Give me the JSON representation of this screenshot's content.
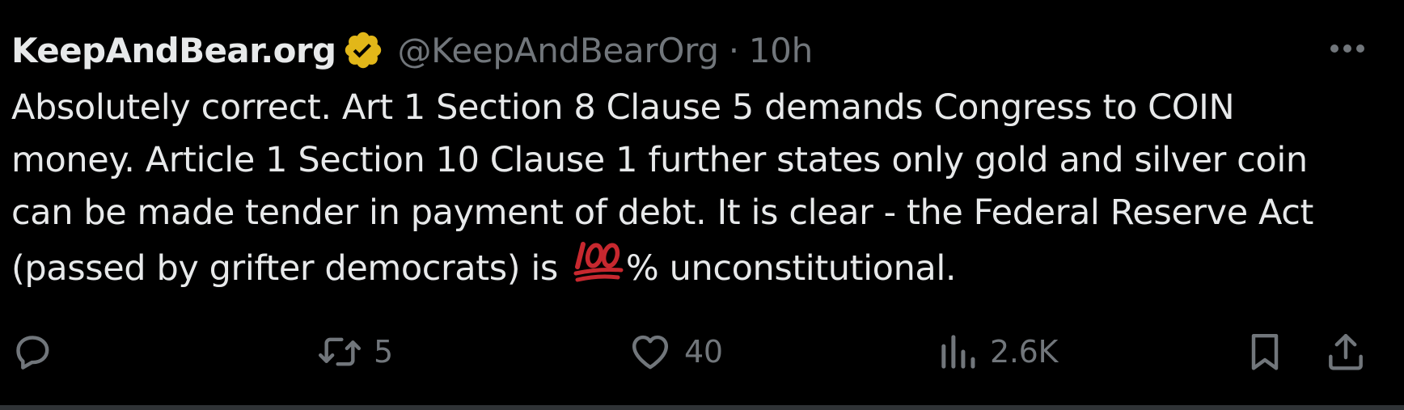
{
  "author": {
    "display_name": "KeepAndBear.org",
    "handle": "@KeepAndBearOrg",
    "separator": "·",
    "time": "10h",
    "verified_icon": "gold-verified-badge-icon"
  },
  "colors": {
    "background": "#000000",
    "text": "#e7e9ea",
    "muted": "#71767b",
    "verified_gold": "#e2b719",
    "emoji_red": "#c7282f"
  },
  "tweet": {
    "lines": [
      "Absolutely correct. Art 1 Section 8 Clause 5 demands Congress to COIN",
      "money. Article 1 Section 10 Clause 1 further states only gold and silver coin",
      "can be made tender in payment of debt. It is clear - the Federal Reserve Act"
    ],
    "last_line_before_emoji": "(passed by grifter democrats) is",
    "emoji_name": "hundred-points-emoji",
    "last_line_after_emoji": "% unconstitutional."
  },
  "actions": {
    "reply": {
      "icon": "reply-icon"
    },
    "retweet": {
      "icon": "retweet-icon",
      "count": "5"
    },
    "like": {
      "icon": "heart-icon",
      "count": "40"
    },
    "views": {
      "icon": "views-chart-icon",
      "count": "2.6K"
    },
    "bookmark": {
      "icon": "bookmark-icon"
    },
    "share": {
      "icon": "share-icon"
    }
  }
}
